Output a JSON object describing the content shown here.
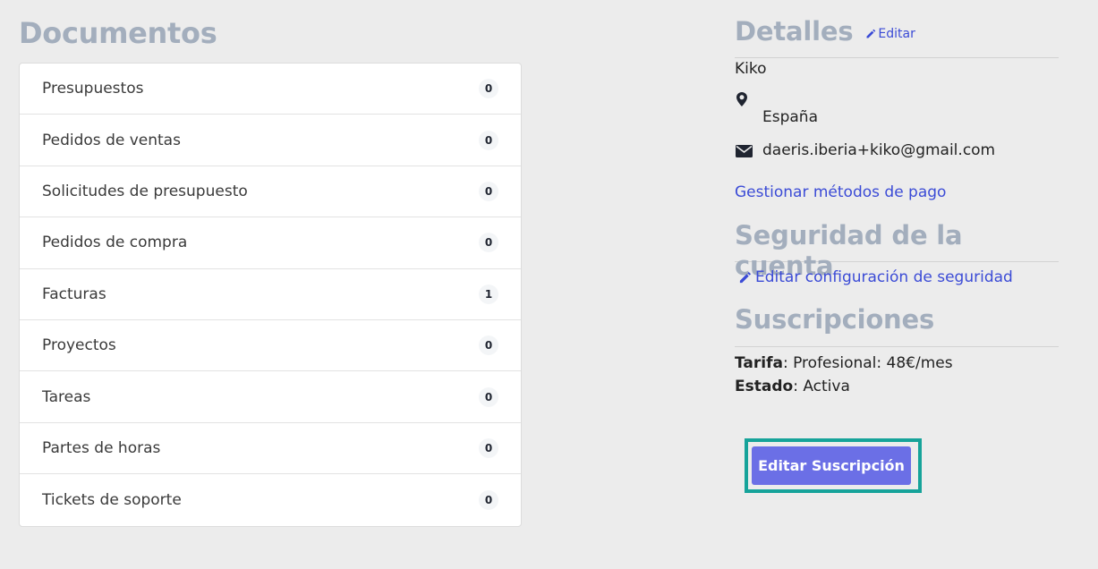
{
  "documents": {
    "title": "Documentos",
    "items": [
      {
        "label": "Presupuestos",
        "count": "0"
      },
      {
        "label": "Pedidos de ventas",
        "count": "0"
      },
      {
        "label": "Solicitudes de presupuesto",
        "count": "0"
      },
      {
        "label": "Pedidos de compra",
        "count": "0"
      },
      {
        "label": "Facturas",
        "count": "1"
      },
      {
        "label": "Proyectos",
        "count": "0"
      },
      {
        "label": "Tareas",
        "count": "0"
      },
      {
        "label": "Partes de horas",
        "count": "0"
      },
      {
        "label": "Tickets de soporte",
        "count": "0"
      }
    ]
  },
  "details": {
    "title": "Detalles",
    "edit_label": "Editar",
    "name": "Kiko",
    "country": "España",
    "email": "daeris.iberia+kiko@gmail.com",
    "payment_link": "Gestionar métodos de pago",
    "icons": {
      "edit": "pencil-icon",
      "location": "map-marker-icon",
      "email": "envelope-icon"
    }
  },
  "security": {
    "title": "Seguridad de la cuenta",
    "edit_link": "Editar configuración de seguridad"
  },
  "subscriptions": {
    "title": "Suscripciones",
    "plan_label": "Tarifa",
    "plan_value": ": Profesional: 48€/mes",
    "state_label": "Estado",
    "state_value": ": Activa",
    "button_label": "Editar Suscripción"
  },
  "colors": {
    "heading": "#a3aebd",
    "link": "#3b4bd6",
    "button": "#6b6fe6",
    "highlight": "#16a39a",
    "background": "#ececec"
  }
}
